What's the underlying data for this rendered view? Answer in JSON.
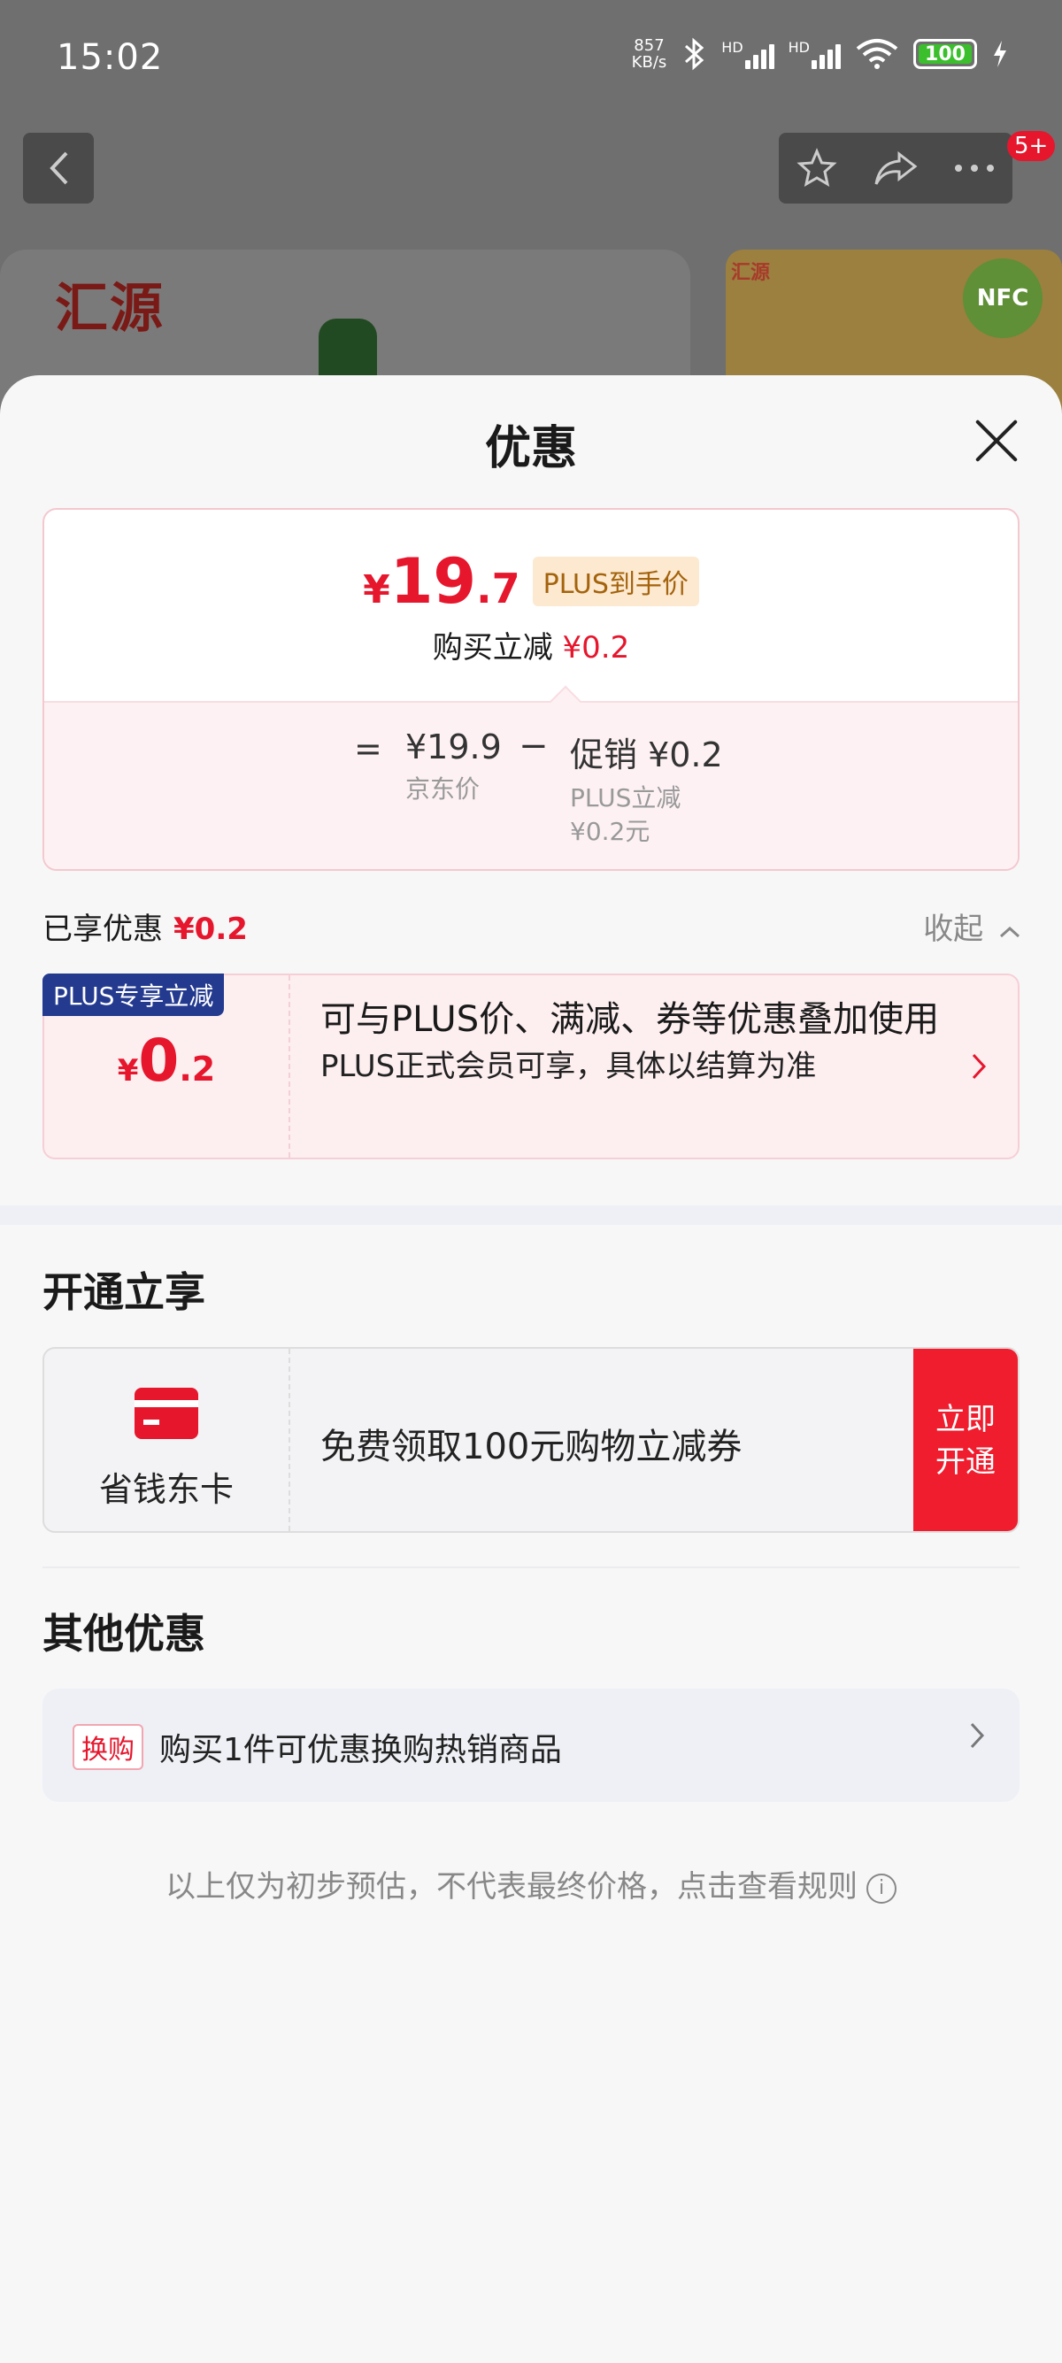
{
  "status_bar": {
    "time": "15:02",
    "net_speed": "857",
    "net_unit": "KB/s",
    "battery": "100",
    "sig1_label": "HD",
    "sig2_label": "HD"
  },
  "header": {
    "back_icon": "chevron-left-icon",
    "badge": "5+"
  },
  "background": {
    "brand_logo_text": "汇源",
    "brand_small": "汇源",
    "nfc_label": "NFC"
  },
  "sheet": {
    "title": "优惠"
  },
  "price_card": {
    "currency": "¥",
    "price_int": "19",
    "price_dec": ".7",
    "plus_tag": "PLUS到手价",
    "buy_label": "购买立减",
    "buy_amount": "¥0.2",
    "equals": "=",
    "jd_price": "¥19.9",
    "jd_price_label": "京东价",
    "minus": "−",
    "promo_label": "促销 ¥0.2",
    "promo_detail1": "PLUS立减",
    "promo_detail2": "¥0.2元"
  },
  "enjoyed": {
    "label": "已享优惠",
    "amount": "¥0.2",
    "collapse_label": "收起"
  },
  "plus_coupon": {
    "tag": "PLUS专享立减",
    "currency": "¥",
    "value_int": "0",
    "value_dec": ".2",
    "line1": "可与PLUS价、满减、券等优惠叠加使用",
    "line2": "PLUS正式会员可享，具体以结算为准"
  },
  "open_section": {
    "title": "开通立享",
    "card_name": "省钱东卡",
    "description": "免费领取100元购物立减券",
    "button_line1": "立即",
    "button_line2": "开通"
  },
  "other_section": {
    "title": "其他优惠",
    "tag": "换购",
    "text": "购买1件可优惠换购热销商品"
  },
  "disclaimer": "以上仅为初步预估，不代表最终价格，点击查看规则",
  "colors": {
    "accent": "#e6162d",
    "plus_blue": "#233a8f",
    "plus_gold": "#a4630c"
  }
}
